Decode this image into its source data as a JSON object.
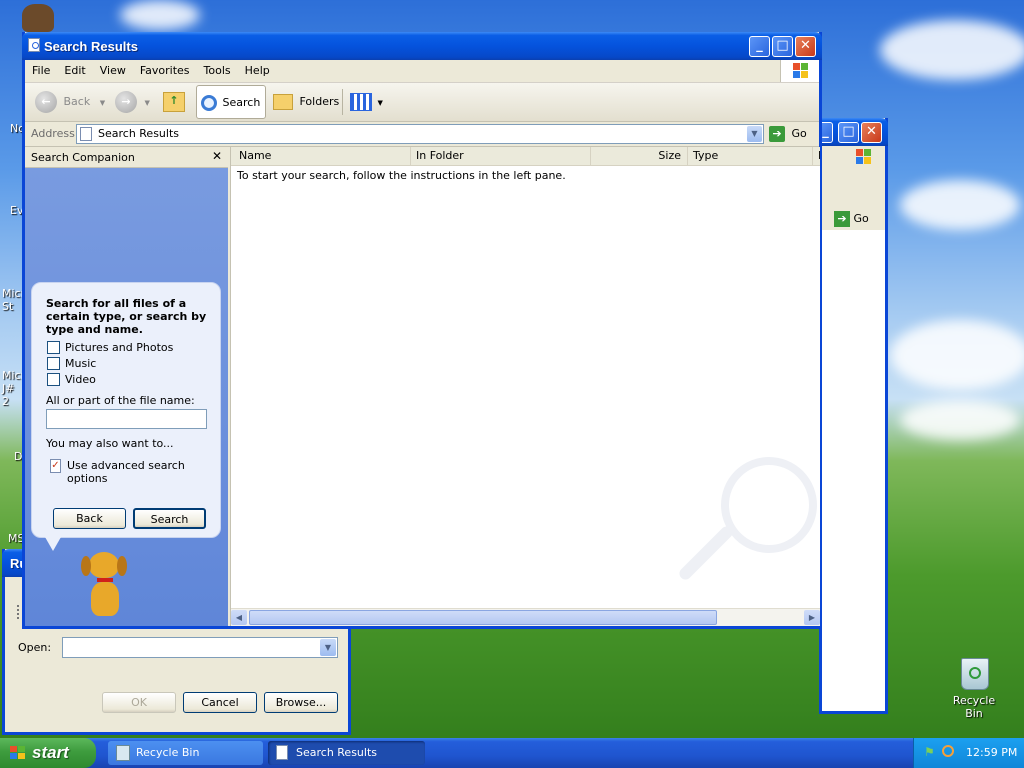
{
  "desktop": {
    "partial_labels": [
      "No",
      "Ev",
      "Micr St",
      "Micr J# 2",
      "D",
      "MS"
    ],
    "recycle_bin_label": "Recycle Bin"
  },
  "back_window": {
    "go_label": "Go"
  },
  "run_dialog": {
    "title_partial": "Ru",
    "open_label": "Open:",
    "open_value": "",
    "ok_label": "OK",
    "cancel_label": "Cancel",
    "browse_label": "Browse..."
  },
  "window": {
    "title": "Search Results",
    "menu": [
      "File",
      "Edit",
      "View",
      "Favorites",
      "Tools",
      "Help"
    ],
    "toolbar": {
      "back_label": "Back",
      "search_label": "Search",
      "folders_label": "Folders"
    },
    "address": {
      "label": "Address",
      "value": "Search Results",
      "go_label": "Go"
    },
    "search_companion": {
      "header": "Search Companion",
      "prompt": "Search for all files of a certain type, or search by type and name.",
      "checkboxes": [
        {
          "label": "Pictures and Photos",
          "checked": false
        },
        {
          "label": "Music",
          "checked": false
        },
        {
          "label": "Video",
          "checked": false
        }
      ],
      "filename_label": "All or part of the file name:",
      "filename_value": "",
      "also_label": "You may also want to...",
      "advanced_label": "Use advanced search options",
      "back_button": "Back",
      "search_button": "Search"
    },
    "results": {
      "columns": [
        "Name",
        "In Folder",
        "Size",
        "Type",
        "D"
      ],
      "message": "To start your search, follow the instructions in the left pane."
    }
  },
  "taskbar": {
    "start_label": "start",
    "items": [
      {
        "label": "Recycle Bin",
        "active": false
      },
      {
        "label": "Search Results",
        "active": true
      }
    ],
    "clock": "12:59 PM"
  }
}
